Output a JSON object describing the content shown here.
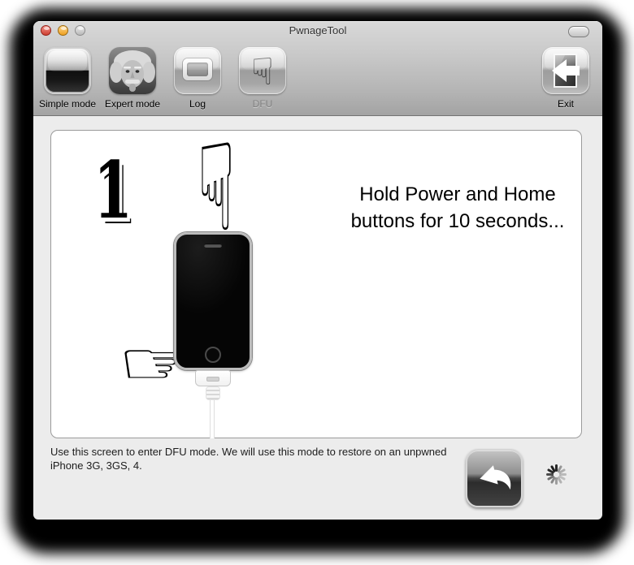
{
  "window": {
    "title": "PwnageTool",
    "traffic_lights": [
      "close",
      "minimize",
      "zoom-disabled"
    ],
    "toolbar_toggle": "pill-button"
  },
  "toolbar": {
    "items": [
      {
        "label": "Simple mode",
        "icon": "simple-mode-icon",
        "selected": false,
        "disabled": false
      },
      {
        "label": "Expert mode",
        "icon": "einstein-photo-icon",
        "selected": true,
        "disabled": false
      },
      {
        "label": "Log",
        "icon": "log-window-icon",
        "selected": false,
        "disabled": false
      },
      {
        "label": "DFU",
        "icon": "dfu-hand-down-icon",
        "selected": false,
        "disabled": true
      },
      {
        "label": "Exit",
        "icon": "exit-door-arrow-icon",
        "selected": false,
        "disabled": false
      }
    ]
  },
  "main": {
    "step_number": "1",
    "headline": "Hold Power and Home buttons for 10 seconds...",
    "illustration": {
      "hand_down_glyph": "☟",
      "hand_right_glyph": "☞",
      "device": "iphone-front-with-dock-cable"
    }
  },
  "footer": {
    "description": "Use this screen to enter DFU mode. We will use this mode to restore on an unpwned iPhone 3G, 3GS, 4.",
    "back_icon": "back-curved-arrow-icon",
    "spinner": "progress-spinner"
  },
  "colors": {
    "selection_blue": "#64aef0",
    "chrome_top": "#d9d9d9",
    "chrome_bottom": "#a3a3a3",
    "content_background": "#ececec",
    "panel_background": "#ffffff"
  }
}
